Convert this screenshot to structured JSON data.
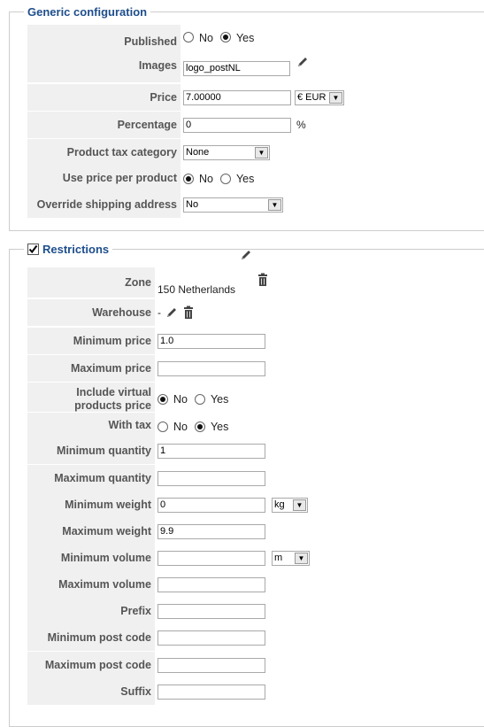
{
  "generic": {
    "legend": "Generic configuration",
    "published": {
      "label": "Published",
      "options": [
        "No",
        "Yes"
      ],
      "selected": "Yes"
    },
    "images": {
      "label": "Images",
      "value": "logo_postNL"
    },
    "price": {
      "label": "Price",
      "value": "7.00000",
      "currency": "€ EUR"
    },
    "percentage": {
      "label": "Percentage",
      "value": "0",
      "unit": "%"
    },
    "tax_category": {
      "label": "Product tax category",
      "value": "None"
    },
    "price_per_product": {
      "label": "Use price per product",
      "options": [
        "No",
        "Yes"
      ],
      "selected": "No"
    },
    "override_shipping": {
      "label": "Override shipping address",
      "value": "No"
    }
  },
  "restrictions": {
    "legend": "Restrictions",
    "enabled": true,
    "zone": {
      "label": "Zone",
      "value": "150 Netherlands"
    },
    "warehouse": {
      "label": "Warehouse",
      "value": "-"
    },
    "min_price": {
      "label": "Minimum price",
      "value": "1.0"
    },
    "max_price": {
      "label": "Maximum price",
      "value": ""
    },
    "include_virtual": {
      "label_line1": "Include virtual",
      "label_line2": "products price",
      "options": [
        "No",
        "Yes"
      ],
      "selected": "No"
    },
    "with_tax": {
      "label": "With tax",
      "options": [
        "No",
        "Yes"
      ],
      "selected": "Yes"
    },
    "min_quantity": {
      "label": "Minimum quantity",
      "value": "1"
    },
    "max_quantity": {
      "label": "Maximum quantity",
      "value": ""
    },
    "min_weight": {
      "label": "Minimum weight",
      "value": "0",
      "unit": "kg"
    },
    "max_weight": {
      "label": "Maximum weight",
      "value": "9.9"
    },
    "min_volume": {
      "label": "Minimum volume",
      "value": "",
      "unit": "m"
    },
    "max_volume": {
      "label": "Maximum volume",
      "value": ""
    },
    "prefix": {
      "label": "Prefix",
      "value": ""
    },
    "min_post_code": {
      "label": "Minimum post code",
      "value": ""
    },
    "max_post_code": {
      "label": "Maximum post code",
      "value": ""
    },
    "suffix": {
      "label": "Suffix",
      "value": ""
    }
  },
  "colors": {
    "legend": "#1e4e8c",
    "label_bg": "#f0f0f0",
    "label_text": "#555555"
  },
  "icons": [
    "pencil-icon",
    "trash-icon",
    "chevron-down-icon",
    "checkbox-checked-icon"
  ]
}
